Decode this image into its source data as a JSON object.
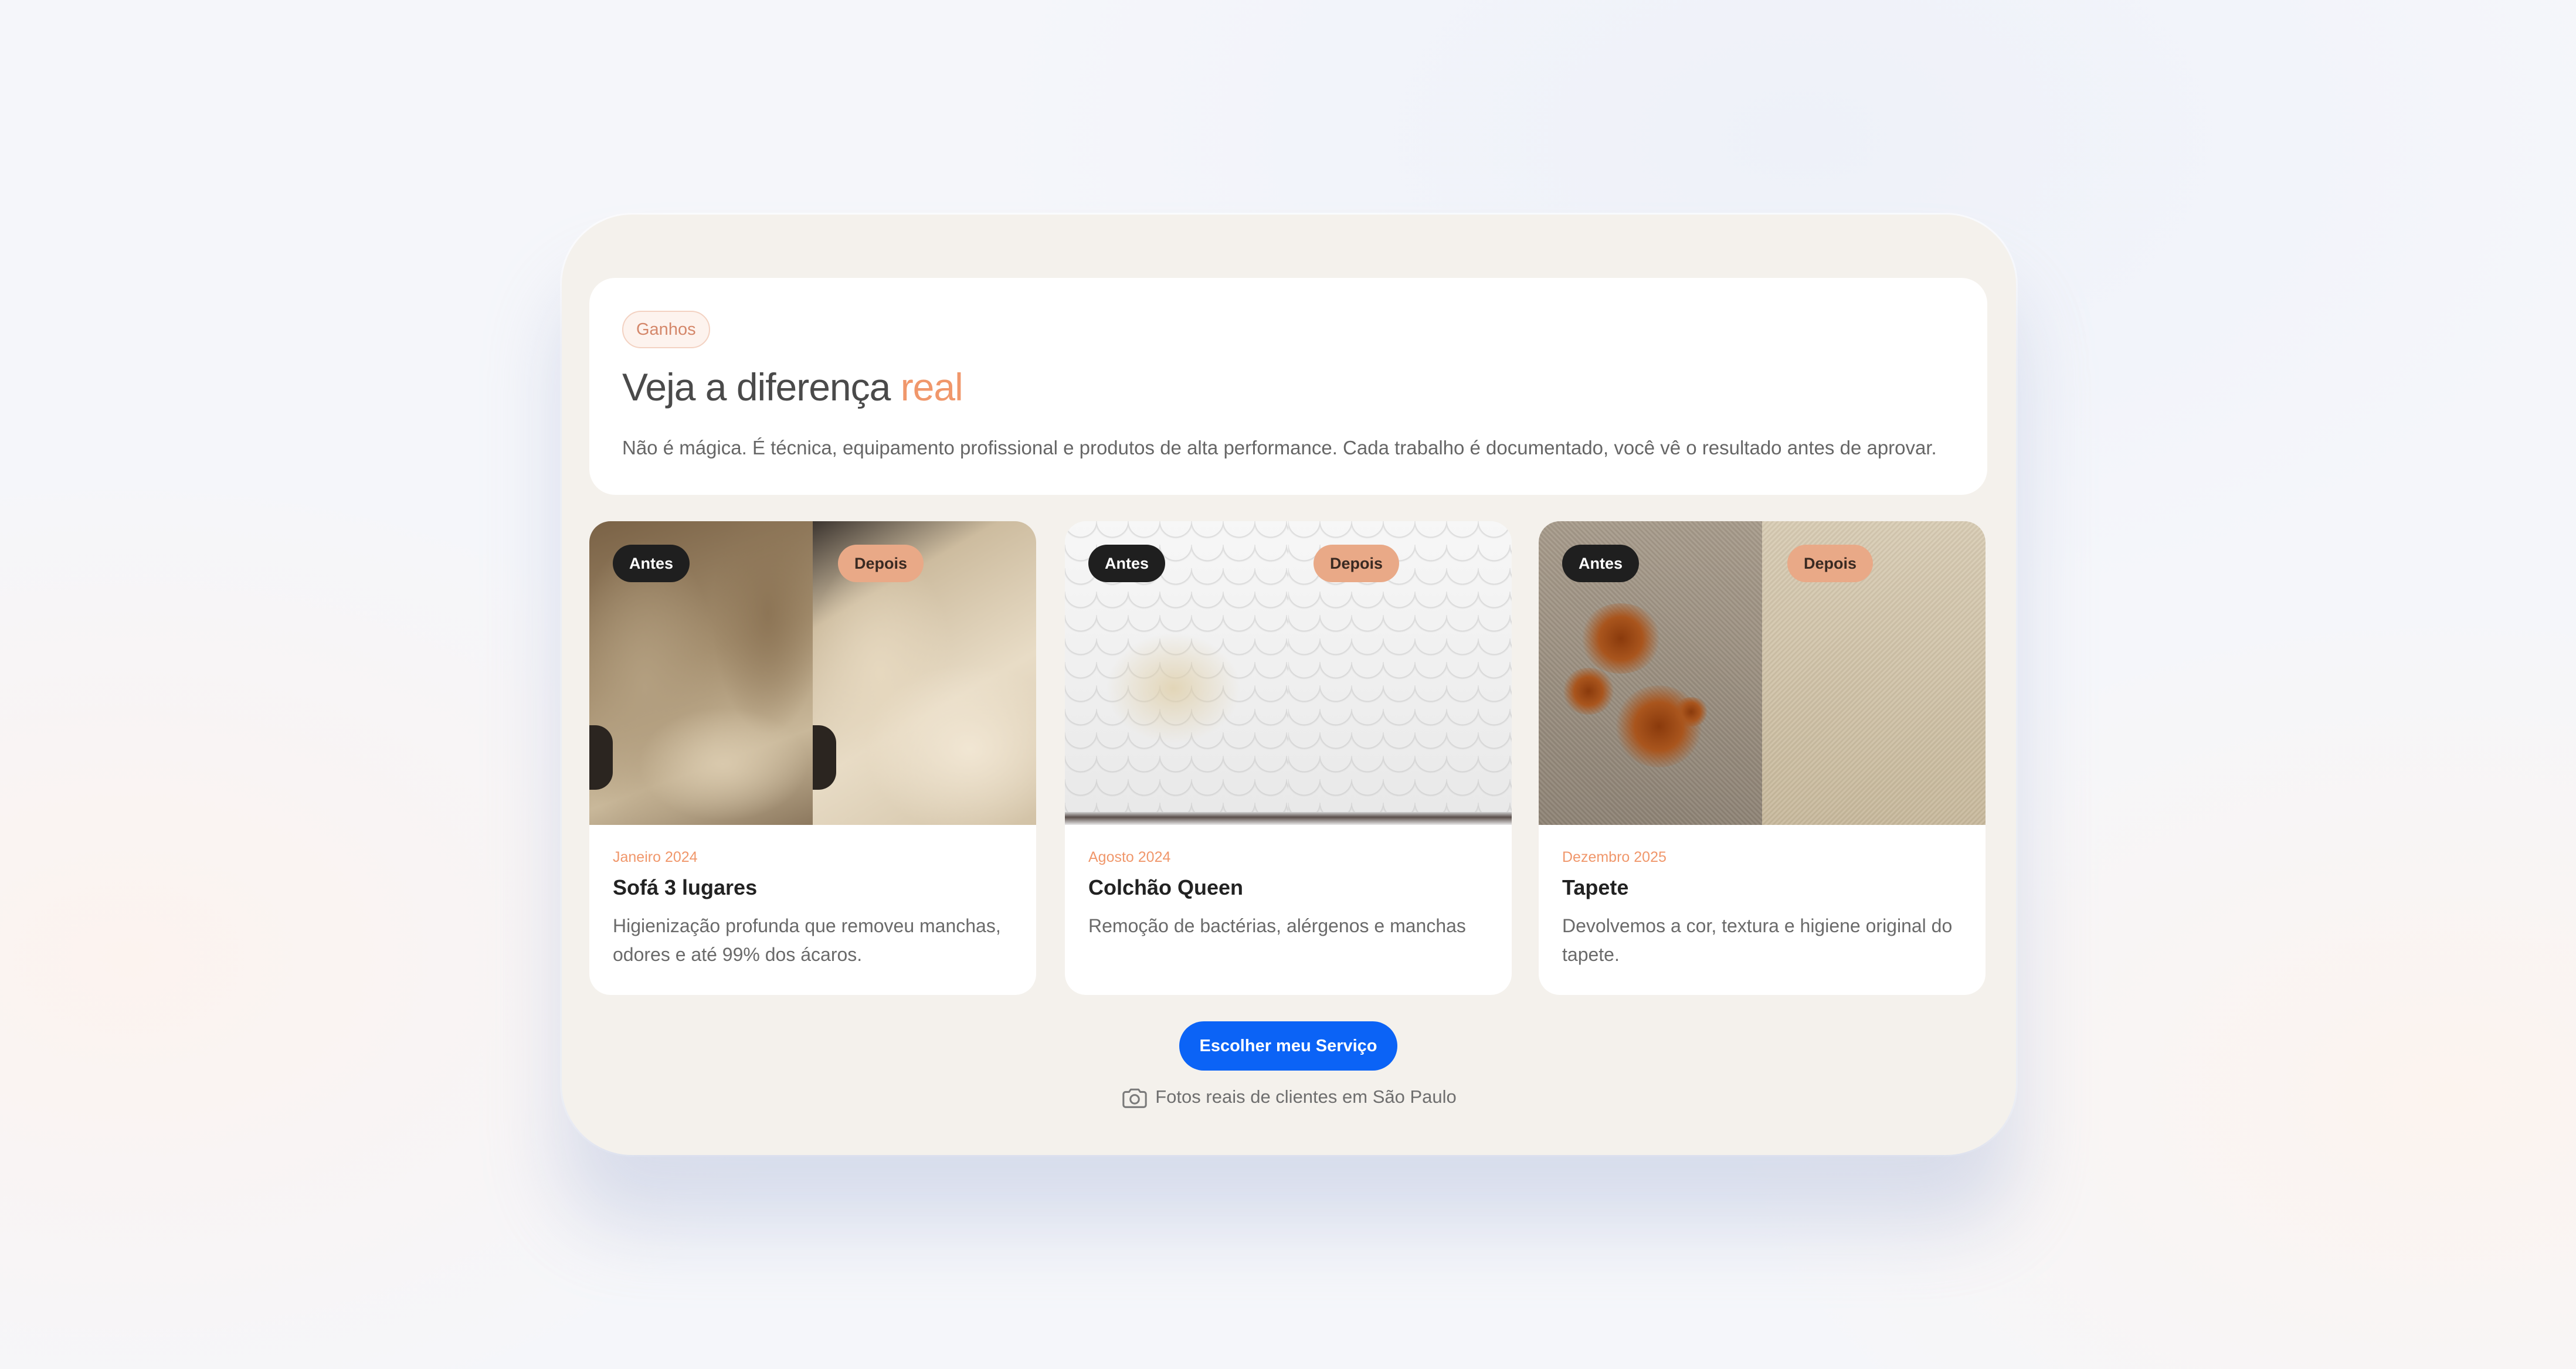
{
  "header": {
    "tag": "Ganhos",
    "title_main": "Veja a diferença",
    "title_accent": "real",
    "subtitle": "Não é mágica. É técnica, equipamento profissional e produtos de alta performance. Cada trabalho é documentado, você vê o resultado antes de aprovar."
  },
  "badges": {
    "before": "Antes",
    "after": "Depois"
  },
  "cards": [
    {
      "date": "Janeiro 2024",
      "title": "Sofá 3 lugares",
      "description": "Higienização profunda que removeu manchas, odores e até 99% dos ácaros."
    },
    {
      "date": "Agosto 2024",
      "title": "Colchão Queen",
      "description": "Remoção de bactérias, alérgenos e manchas"
    },
    {
      "date": "Dezembro 2025",
      "title": "Tapete",
      "description": "Devolvemos a cor, textura e higiene original do tapete."
    }
  ],
  "cta": {
    "label": "Escolher meu Serviço"
  },
  "footnote": {
    "text": "Fotos reais de clientes em São Paulo",
    "icon": "camera-icon"
  },
  "colors": {
    "accent": "#f0976b",
    "cta": "#0b63f6",
    "panel": "#f4f1ec"
  }
}
